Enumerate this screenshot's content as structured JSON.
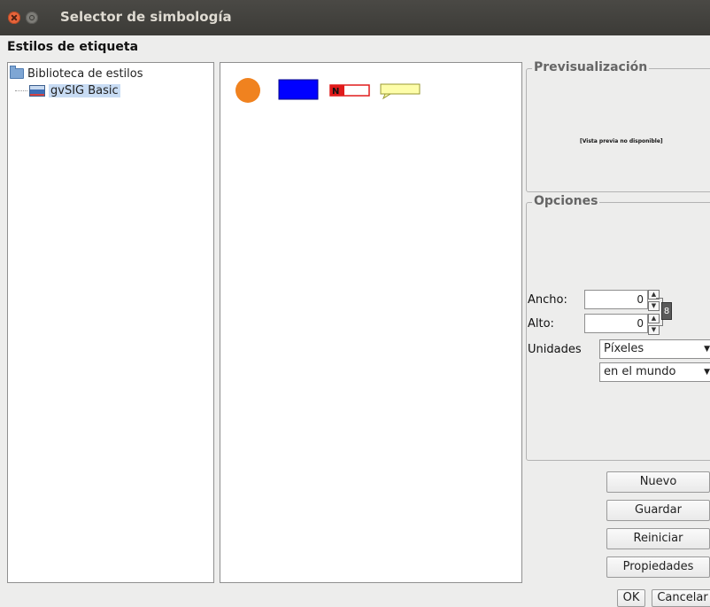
{
  "window": {
    "title": "Selector de simbología"
  },
  "section_title": "Estilos de etiqueta",
  "tree": {
    "root_label": "Biblioteca de estilos",
    "child_label": "gvSIG Basic"
  },
  "styles": [
    {
      "name": "orange-circle-style",
      "color": "#f0821f"
    },
    {
      "name": "blue-rectangle-style",
      "color": "#0000ff"
    },
    {
      "name": "red-number-label-style",
      "color": "#e01b1b",
      "text": "N"
    },
    {
      "name": "yellow-callout-style",
      "color": "#fdfda9"
    }
  ],
  "preview": {
    "title": "Previsualización",
    "placeholder": "[Vista previa no disponible]"
  },
  "options": {
    "title": "Opciones",
    "width_label": "Ancho:",
    "width_value": "0",
    "height_label": "Alto:",
    "height_value": "0",
    "units_label": "Unidades",
    "units_value": "Píxeles",
    "reference_value": "en el mundo"
  },
  "buttons": {
    "new": "Nuevo",
    "save": "Guardar",
    "reset": "Reiniciar",
    "properties": "Propiedades",
    "ok": "OK",
    "cancel": "Cancelar"
  }
}
